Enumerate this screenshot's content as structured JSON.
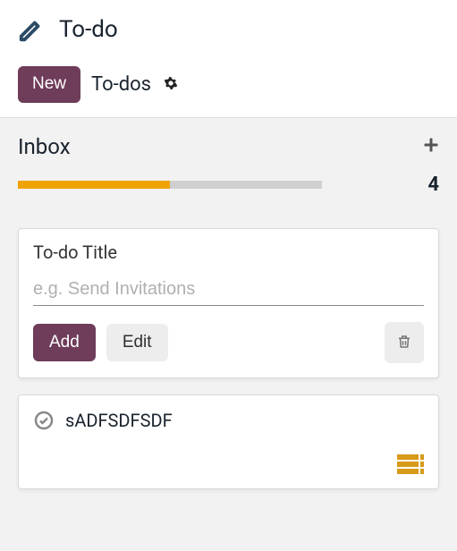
{
  "header": {
    "title": "To-do",
    "new_button": "New",
    "tab_label": "To-dos"
  },
  "inbox": {
    "label": "Inbox",
    "progress_percent": 50,
    "count": "4"
  },
  "form": {
    "label": "To-do Title",
    "placeholder": "e.g. Send Invitations",
    "value": "",
    "add": "Add",
    "edit": "Edit"
  },
  "items": [
    {
      "title": "sADFSDFSDF",
      "done": false
    }
  ],
  "colors": {
    "accent": "#6f3c59",
    "progress": "#f0a306"
  }
}
